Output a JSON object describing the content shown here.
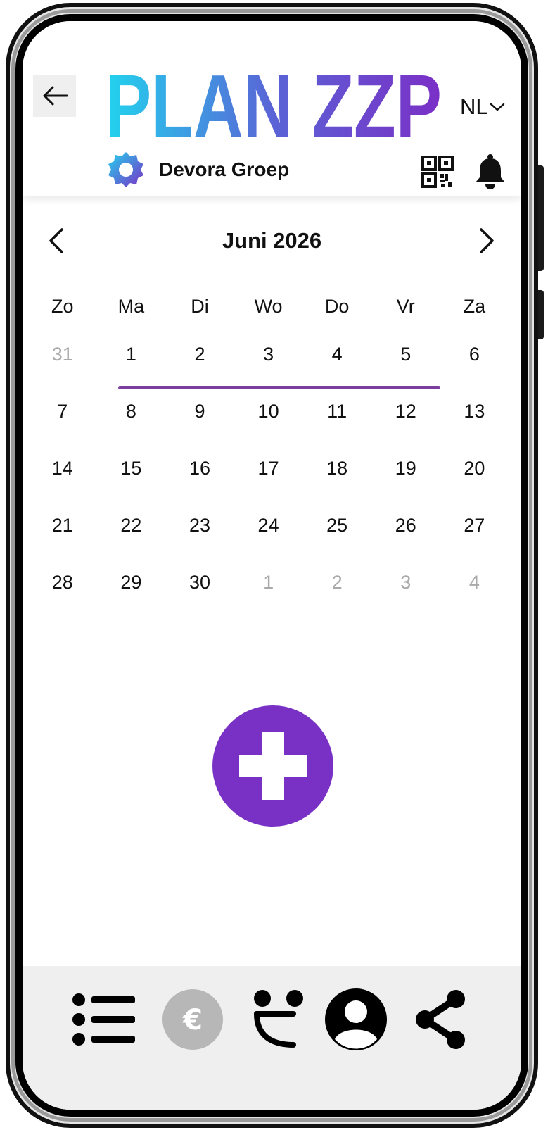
{
  "header": {
    "logo_text": "PLAN ZZP",
    "language": "NL",
    "organization": "Devora Groep"
  },
  "calendar": {
    "month_title": "Juni 2026",
    "weekdays": [
      "Zo",
      "Ma",
      "Di",
      "Wo",
      "Do",
      "Vr",
      "Za"
    ],
    "weeks": [
      [
        "31",
        "1",
        "2",
        "3",
        "4",
        "5",
        "6"
      ],
      [
        "7",
        "8",
        "9",
        "10",
        "11",
        "12",
        "13"
      ],
      [
        "14",
        "15",
        "16",
        "17",
        "18",
        "19",
        "20"
      ],
      [
        "21",
        "22",
        "23",
        "24",
        "25",
        "26",
        "27"
      ],
      [
        "28",
        "29",
        "30",
        "1",
        "2",
        "3",
        "4"
      ]
    ],
    "muted_cells": [
      [
        0,
        0
      ],
      [
        4,
        3
      ],
      [
        4,
        4
      ],
      [
        4,
        5
      ],
      [
        4,
        6
      ]
    ],
    "highlighted_week": {
      "row": 0,
      "from_col": 1,
      "to_col": 5
    }
  },
  "bottom_nav": {
    "items": [
      "list-icon",
      "euro-icon",
      "face-icon",
      "profile-icon",
      "share-icon"
    ],
    "euro_symbol": "€"
  },
  "colors": {
    "accent": "#7831c4",
    "week_bar": "#7a3f9f",
    "logo_gradient_start": "#22d3ee",
    "logo_gradient_end": "#7b2fc6",
    "muted_text": "#a9a9a9",
    "nav_background": "#efefef"
  }
}
